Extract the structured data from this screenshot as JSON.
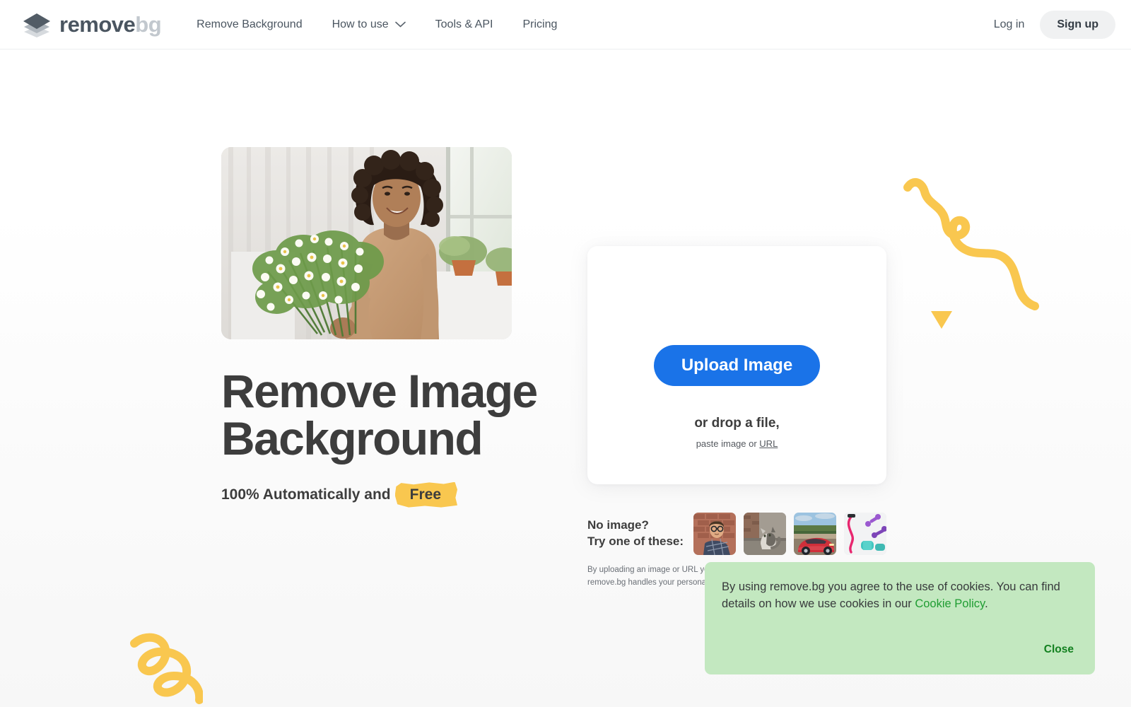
{
  "header": {
    "logo": {
      "icon": "layers-diamond-icon",
      "word1": "remove",
      "word2": "bg"
    },
    "nav": [
      {
        "label": "Remove Background",
        "has_chevron": false
      },
      {
        "label": "How to use",
        "has_chevron": true
      },
      {
        "label": "Tools & API",
        "has_chevron": false
      },
      {
        "label": "Pricing",
        "has_chevron": false
      }
    ],
    "login_label": "Log in",
    "signup_label": "Sign up"
  },
  "hero": {
    "photo_alt": "Smiling woman holding a bouquet of white daisies indoors",
    "title": "Remove Image\nBackground",
    "subtitle_prefix": "100% Automatically and",
    "subtitle_badge": "Free"
  },
  "upload": {
    "button_label": "Upload Image",
    "drop_label": "or drop a file,",
    "paste_prefix": "paste image or ",
    "paste_link": "URL"
  },
  "samples": {
    "label_line1": "No image?",
    "label_line2": "Try one of these:",
    "thumbs": [
      {
        "name": "sample-man-glasses",
        "alt": "Man with glasses in plaid shirt against brick wall"
      },
      {
        "name": "sample-cat",
        "alt": "Cat sitting on concrete ledge"
      },
      {
        "name": "sample-red-car",
        "alt": "Red sports car on a road"
      },
      {
        "name": "sample-fitness",
        "alt": "Fitness equipment, dumbbells and resistance bands"
      }
    ]
  },
  "fineprint": {
    "line1": "By uploading an image or URL you a",
    "line2": "remove.bg handles your personal d"
  },
  "cookie": {
    "text_before": "By using remove.bg you agree to the use of cookies. You can find details on how we use cookies in our ",
    "link_label": "Cookie Policy",
    "text_after": ".",
    "close_label": "Close"
  },
  "decor": {
    "squiggle_top_right": "yellow-squiggle-icon",
    "triangle": "yellow-triangle-icon",
    "squiggle_bottom_left": "yellow-spiral-squiggle-icon"
  },
  "colors": {
    "accent_blue": "#1a73e8",
    "yellow": "#f9c74f",
    "banner_green": "#c3e8c0",
    "link_green": "#1f9d32",
    "text_dark": "#3d3d3d",
    "nav_text": "#4a5560"
  }
}
